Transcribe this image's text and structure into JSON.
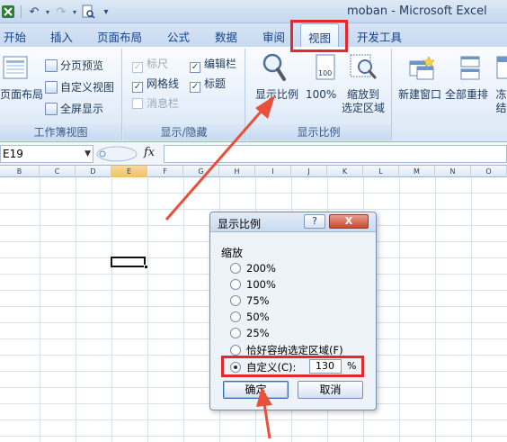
{
  "window": {
    "title": "moban - Microsoft Excel"
  },
  "qat": {
    "icons": [
      "excel-logo-icon",
      "undo-icon",
      "redo-icon",
      "print-preview-icon",
      "customize-icon"
    ]
  },
  "tabs": [
    {
      "label": "开始"
    },
    {
      "label": "插入"
    },
    {
      "label": "页面布局"
    },
    {
      "label": "公式"
    },
    {
      "label": "数据"
    },
    {
      "label": "审阅"
    },
    {
      "label": "视图",
      "active": true
    },
    {
      "label": "开发工具"
    }
  ],
  "ribbon": {
    "workbook_views": {
      "label": "工作簿视图",
      "page_layout": "页面布局",
      "page_break_preview": "分页预览",
      "custom_views": "自定义视图",
      "full_screen": "全屏显示"
    },
    "show_hide": {
      "label": "显示/隐藏",
      "ruler": "标尺",
      "formula_bar": "编辑栏",
      "gridlines": "网格线",
      "headings": "标题",
      "message_bar": "消息栏"
    },
    "zoom": {
      "label": "显示比例",
      "zoom_btn": "显示比例",
      "hundred": "100%",
      "zoom_selection_line1": "缩放到",
      "zoom_selection_line2": "选定区域",
      "hundred_icon_text": "100"
    },
    "window": {
      "new_window": "新建窗口",
      "arrange_all": "全部重排",
      "freeze": "冻结"
    }
  },
  "formula_bar": {
    "namebox": "E19",
    "fx": "fx",
    "value": ""
  },
  "columns": [
    "B",
    "C",
    "D",
    "E",
    "F",
    "G",
    "H",
    "I",
    "J",
    "K",
    "L",
    "M",
    "N",
    "O"
  ],
  "dialog": {
    "title": "显示比例",
    "help": "?",
    "close": "X",
    "group_label": "缩放",
    "options": [
      {
        "label": "200%"
      },
      {
        "label": "100%"
      },
      {
        "label": "75%"
      },
      {
        "label": "50%"
      },
      {
        "label": "25%"
      },
      {
        "label": "恰好容纳选定区域(F)"
      },
      {
        "label": "自定义(C):",
        "checked": true
      }
    ],
    "custom_value": "130",
    "percent": "%",
    "ok": "确定",
    "cancel": "取消"
  },
  "colors": {
    "highlight": "#e4282d",
    "arrow": "#e8503a"
  }
}
